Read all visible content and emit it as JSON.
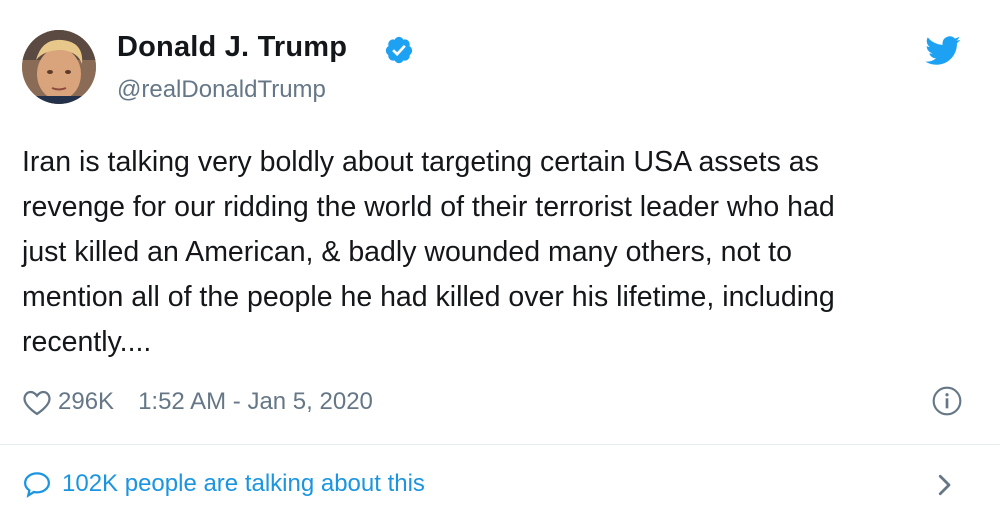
{
  "author": {
    "name": "Donald J. Trump",
    "handle": "@realDonaldTrump",
    "verified": true,
    "avatar_icon": "profile-photo"
  },
  "tweet": {
    "text": "Iran is talking very boldly about targeting certain USA assets as\nrevenge for our ridding the world of their terrorist leader who had\njust killed an American, & badly wounded many others, not to\nmention all of the people he had killed over his lifetime, including\nrecently...."
  },
  "meta": {
    "likes": "296K",
    "timestamp": "1:52 AM - Jan 5, 2020"
  },
  "footer": {
    "talking_label": "102K people are talking about this"
  },
  "icons": {
    "logo": "twitter-bird-icon",
    "verified": "verified-badge-icon",
    "like": "heart-icon",
    "info": "info-icon",
    "comments": "speech-bubble-icon",
    "expand": "chevron-right-icon"
  },
  "colors": {
    "twitter_blue": "#1da1f2",
    "link_blue": "#1b95e0",
    "text_primary": "#14171a",
    "text_secondary": "#657786",
    "divider": "#e6ecf0"
  }
}
